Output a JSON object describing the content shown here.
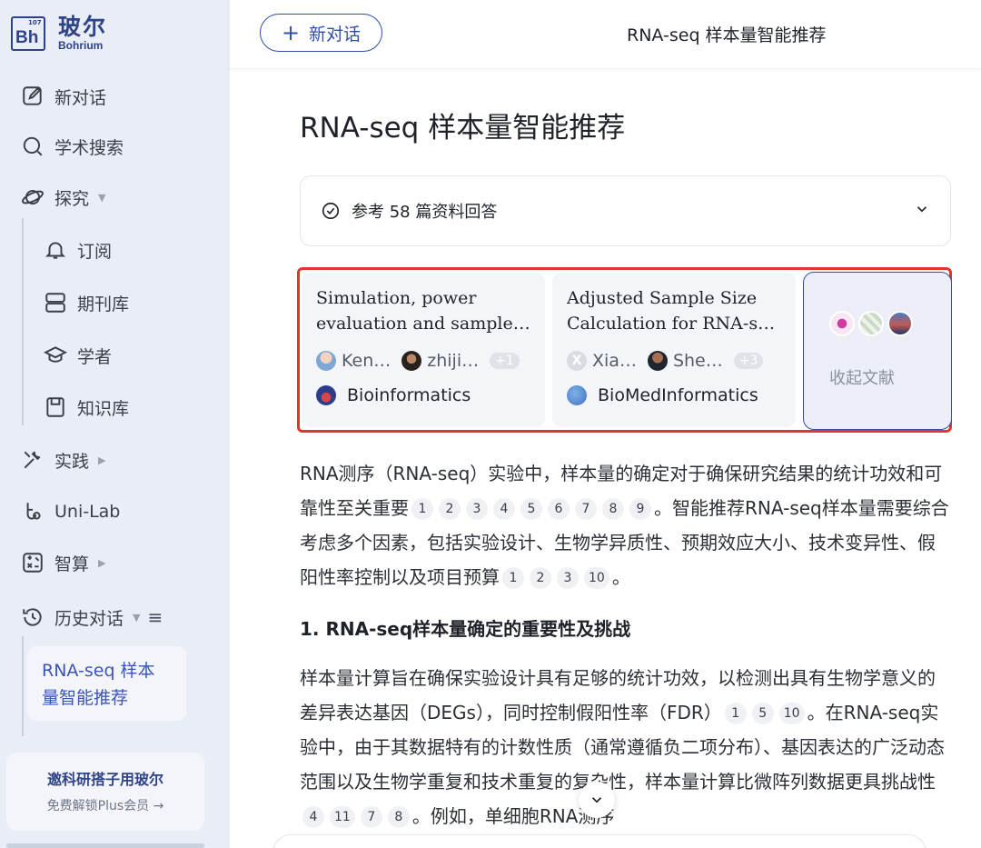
{
  "brand": {
    "cn": "玻尔",
    "en": "Bohrium",
    "symbol": "Bh",
    "number": "107"
  },
  "sidebar": {
    "items": [
      {
        "label": "新对话",
        "icon": "edit-icon"
      },
      {
        "label": "学术搜索",
        "icon": "search-icon"
      },
      {
        "label": "探究",
        "icon": "planet-icon"
      },
      {
        "label": "订阅",
        "icon": "bell-icon"
      },
      {
        "label": "期刊库",
        "icon": "journal-icon"
      },
      {
        "label": "学者",
        "icon": "graduation-cap-icon"
      },
      {
        "label": "知识库",
        "icon": "save-icon"
      },
      {
        "label": "实践",
        "icon": "tools-icon"
      },
      {
        "label": "Uni-Lab",
        "icon": "lab-icon"
      },
      {
        "label": "智算",
        "icon": "calculator-icon"
      },
      {
        "label": "历史对话",
        "icon": "history-icon"
      }
    ],
    "history": [
      "RNA-seq 样本量智能推荐"
    ],
    "invite": {
      "title": "邀科研搭子用玻尔",
      "subtitle": "免费解锁Plus会员 →"
    }
  },
  "header": {
    "new_chat": "新对话",
    "title": "RNA-seq 样本量智能推荐"
  },
  "main": {
    "title": "RNA-seq 样本量智能推荐",
    "references": "参考 58 篇资料回答",
    "cards": [
      {
        "title_line1": "Simulation, power",
        "title_line2": "evaluation and sample size recommendation",
        "author1": "Ken…",
        "author2": "zhiji…",
        "more": "+1",
        "journal": "Bioinformatics"
      },
      {
        "title_line1": "Adjusted Sample Size",
        "title_line2": "Calculation for RNA-seq data",
        "author1": "Xia…",
        "author2": "She…",
        "more": "+3",
        "journal": "BioMedInformatics"
      }
    ],
    "collapse_label": "收起文献",
    "paragraph1": {
      "text_a": "RNA测序（RNA-seq）实验中，样本量的确定对于确保研究结果的统计功效和可靠性至关重要",
      "cites_a": [
        "1",
        "2",
        "3",
        "4",
        "5",
        "6",
        "7",
        "8",
        "9"
      ],
      "text_b": "。智能推荐RNA-seq样本量需要综合考虑多个因素，包括实验设计、生物学异质性、预期效应大小、技术变异性、假阳性率控制以及项目预算",
      "cites_b": [
        "1",
        "2",
        "3",
        "10"
      ],
      "text_c": "。"
    },
    "heading": "1. RNA-seq样本量确定的重要性及挑战",
    "paragraph2": {
      "text_a": "样本量计算旨在确保实验设计具有足够的统计功效，以检测出具有生物学意义的差异表达基因（DEGs），同时控制假阳性率（FDR）",
      "cites_a": [
        "1",
        "5",
        "10"
      ],
      "text_b": "。在RNA-seq实验中，由于其数据特有的计数性质（通常遵循负二项分布）、基因表达的广泛动态范围以及生物学重复和技术重复的复杂性，样本量计算比微阵列数据更具挑战性",
      "cites_b": [
        "4",
        "11",
        "7",
        "8"
      ],
      "text_c": "。例如，单细胞RNA测序"
    }
  },
  "colors": {
    "accent": "#3050a8",
    "highlight_border": "#e0362c",
    "sidebar_bg": "#e9edf6"
  }
}
